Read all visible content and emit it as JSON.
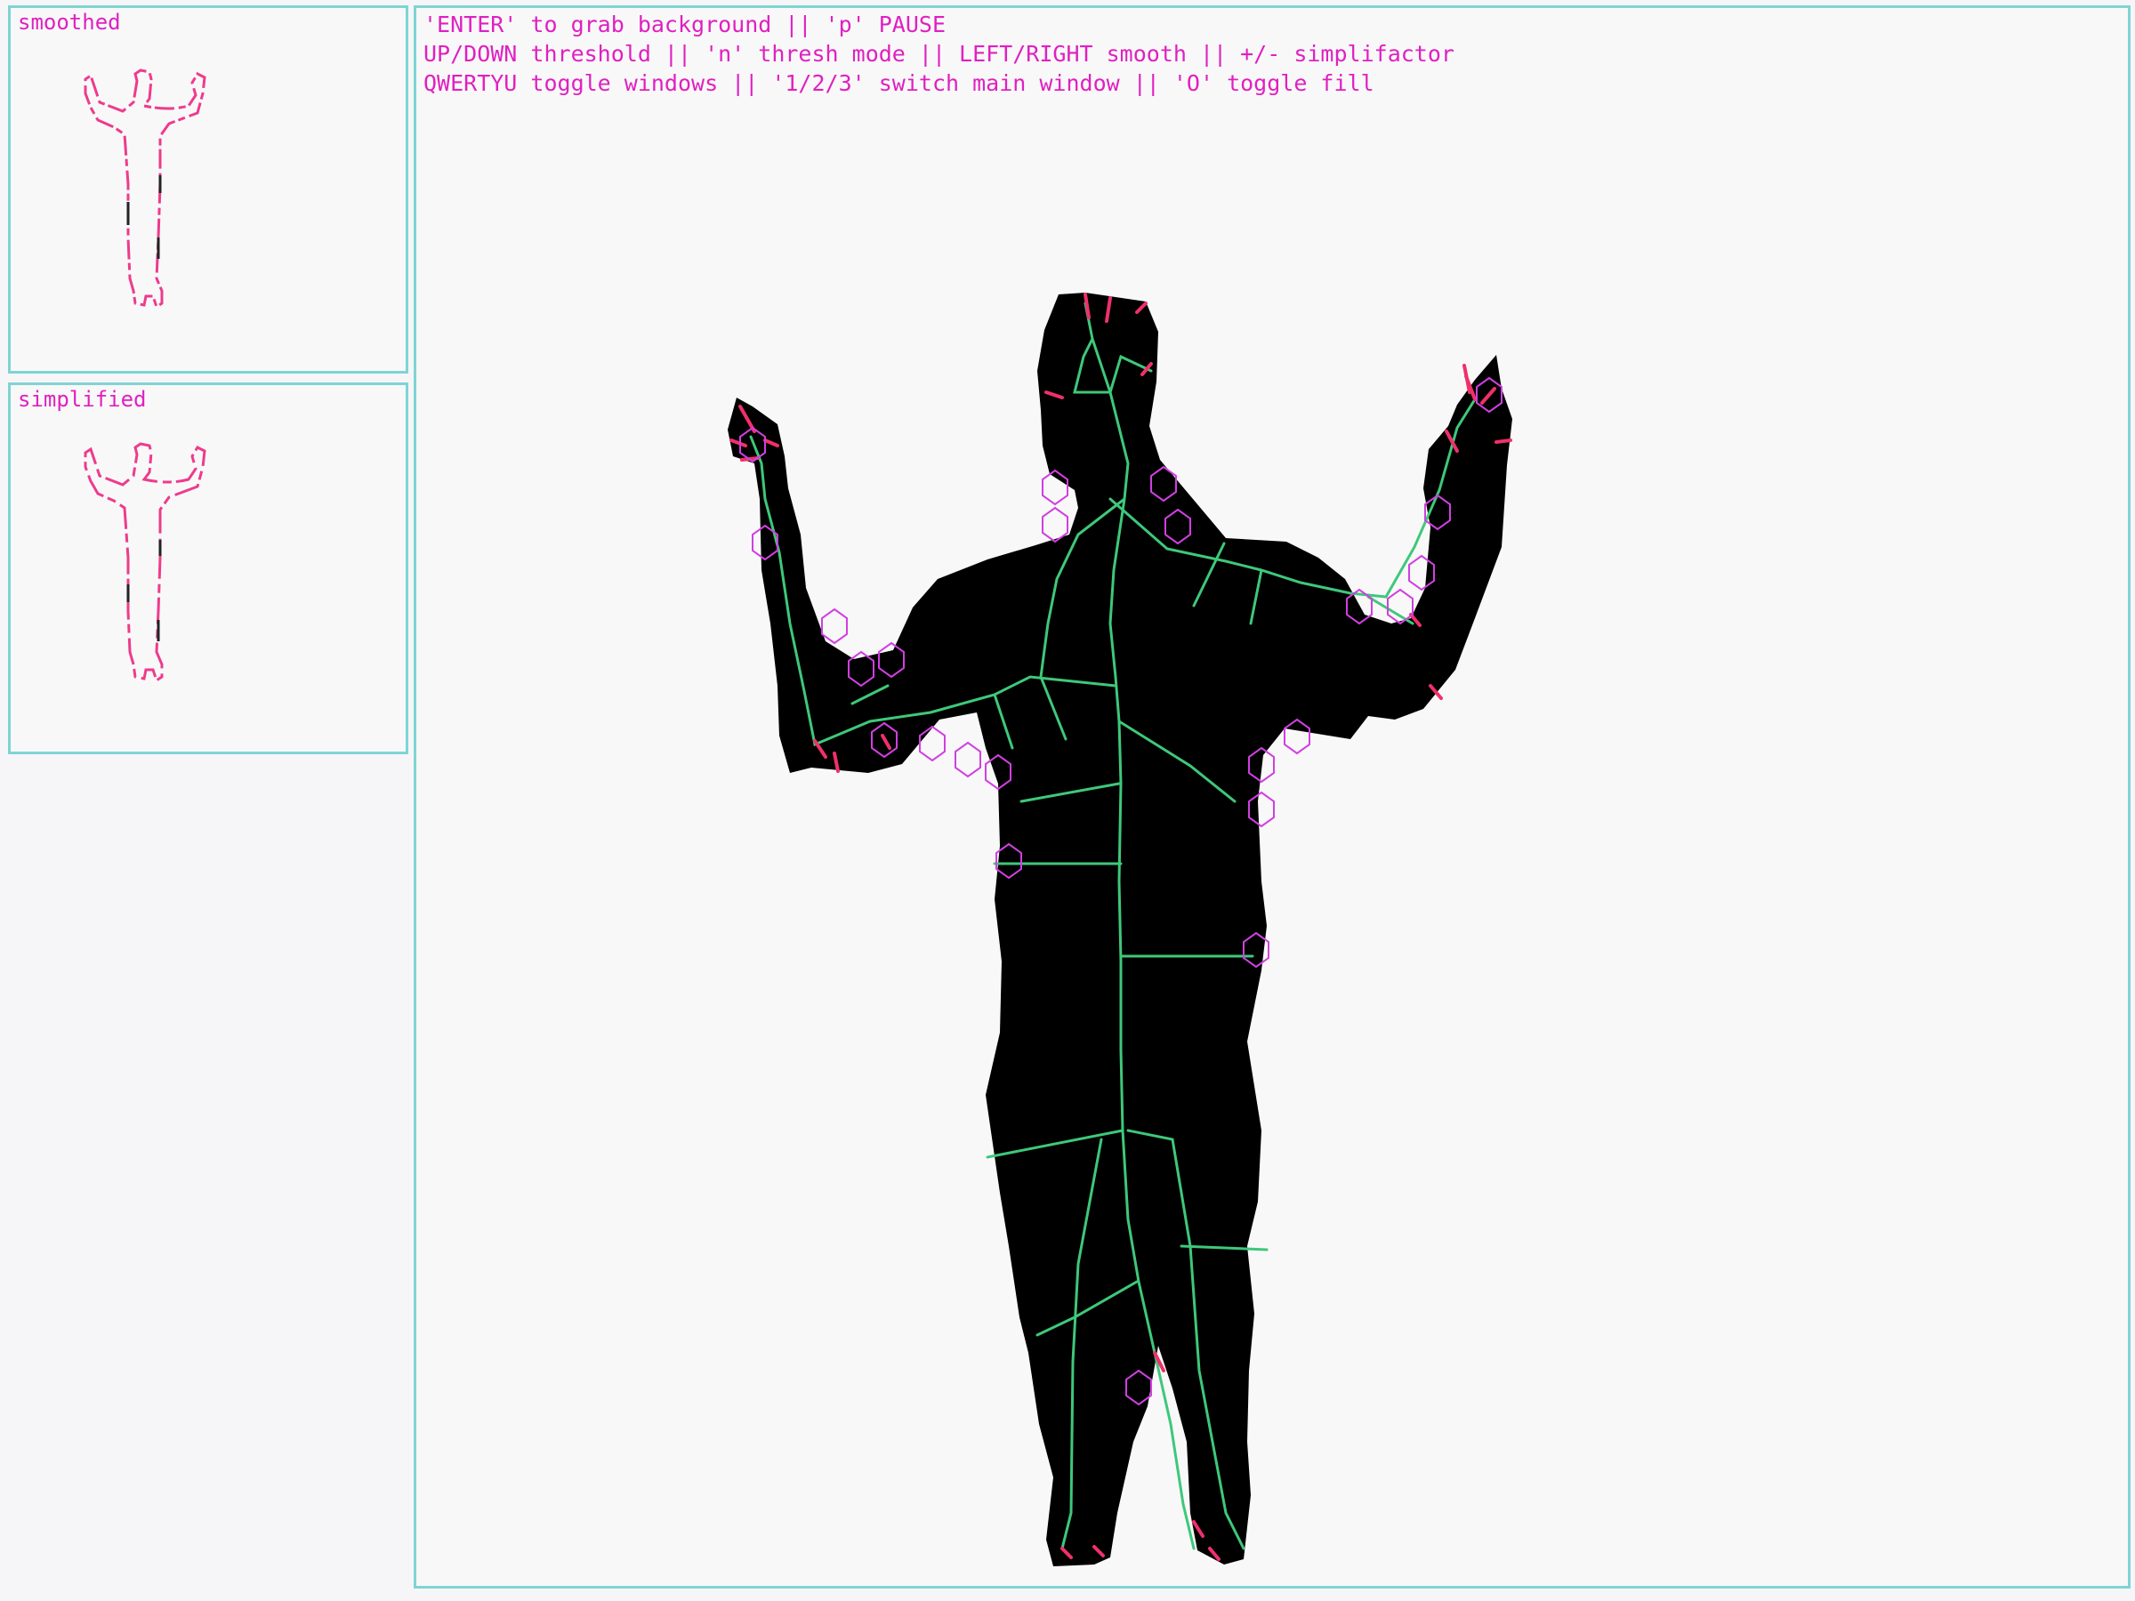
{
  "panels": {
    "smoothed": {
      "label": "smoothed"
    },
    "simplified": {
      "label": "simplified"
    }
  },
  "main": {
    "help": [
      "'ENTER' to grab background || 'p' PAUSE",
      "UP/DOWN threshold || 'n' thresh mode || LEFT/RIGHT smooth || +/- simplifactor",
      "QWERTYU toggle windows || '1/2/3' switch main window || 'O' toggle fill"
    ]
  },
  "colors": {
    "accent": "#e020c0",
    "border": "#7fd4d4",
    "silhouette": "#000000",
    "skeleton": "#3ec87a",
    "markers": "#d040e0",
    "background": "#f8f8f9"
  }
}
